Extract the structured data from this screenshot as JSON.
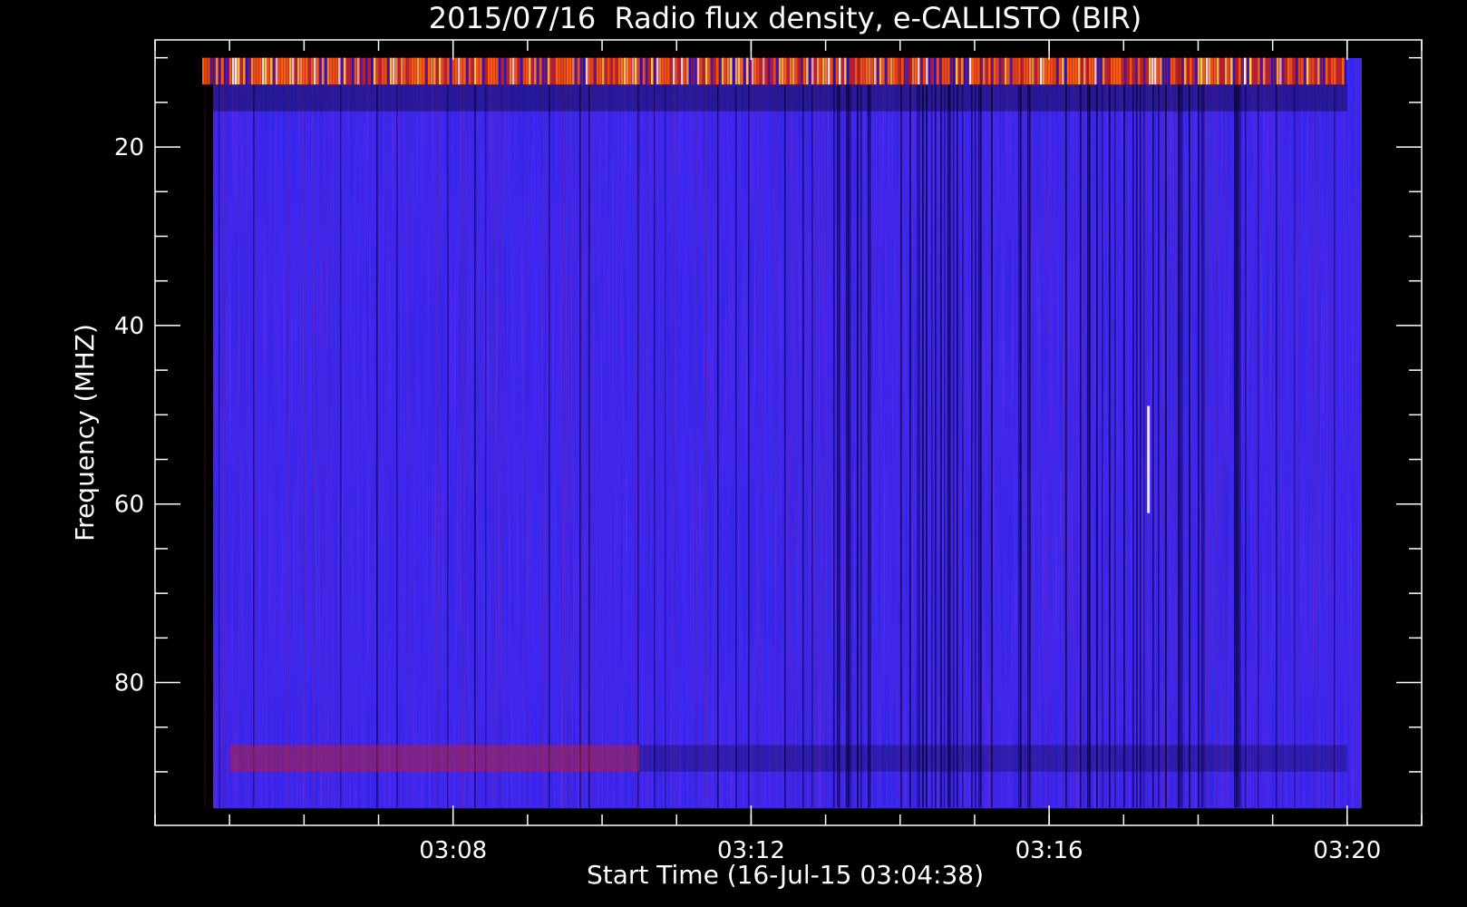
{
  "chart_data": {
    "type": "heatmap",
    "title": "2015/07/16  Radio flux density, e-CALLISTO (BIR)",
    "xlabel": "Start Time (16-Jul-15 03:04:38)",
    "ylabel": "Frequency (MHZ)",
    "x_unit": "UT time",
    "xlim": [
      "03:04:38",
      "03:20:00"
    ],
    "x_axis_range": [
      "03:04",
      "03:21"
    ],
    "x_ticks": [
      "03:08",
      "03:12",
      "03:16",
      "03:20"
    ],
    "ylim": [
      10,
      94
    ],
    "y_axis_range": [
      8,
      96
    ],
    "y_ticks": [
      20,
      40,
      60,
      80
    ],
    "y_reversed": true,
    "grid": false,
    "colormap": [
      "#000000",
      "#1414c8",
      "#3a28ff",
      "#8c1e3c",
      "#c81e14",
      "#ff6400",
      "#ffd250",
      "#ffffff"
    ],
    "features": [
      {
        "label": "strong emission band near top of frequency range",
        "freq_range": [
          10,
          13
        ],
        "intensity": "high"
      },
      {
        "label": "low-intensity vertical dropouts",
        "time_range": [
          "03:12:40",
          "03:18:40"
        ],
        "intensity": "low"
      },
      {
        "label": "interference band",
        "freq_range": [
          87,
          90
        ],
        "time_range": [
          "03:05:00",
          "03:10:30"
        ],
        "intensity": "medium"
      },
      {
        "label": "isolated burst",
        "freq_range": [
          49,
          61
        ],
        "time": "03:17:20",
        "intensity": "high"
      }
    ]
  }
}
